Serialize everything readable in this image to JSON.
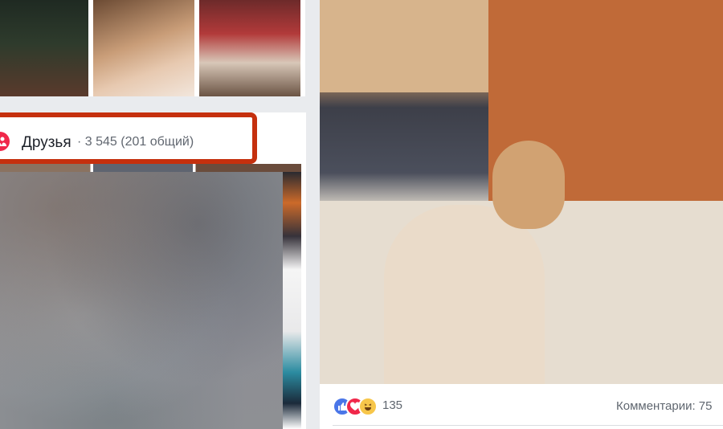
{
  "friends": {
    "title": "Друзья",
    "count": "· 3 545 (201 общий)"
  },
  "post": {
    "reaction_count": "135",
    "comments": "Комментарии: 75"
  },
  "icons": {
    "friends": "friends-icon",
    "like": "like-reaction-icon",
    "love": "love-reaction-icon",
    "haha": "haha-reaction-icon"
  },
  "colors": {
    "highlight_frame": "#c5300e",
    "friends_icon_bg": "#f0284a",
    "like_blue": "#4a76e8"
  }
}
